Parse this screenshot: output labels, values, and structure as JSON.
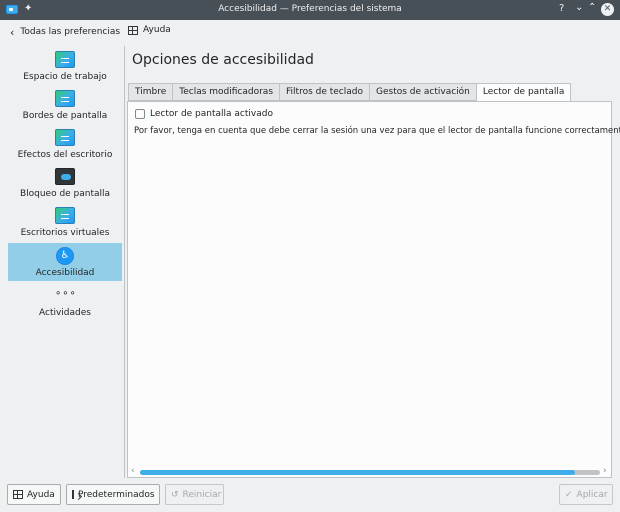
{
  "window": {
    "title": "Accesibilidad  — Preferencias del sistema",
    "help_glyph": "?",
    "minimize_glyph": "⌄",
    "maximize_glyph": "⌃",
    "close_glyph": "✕"
  },
  "toolbar": {
    "back_glyph": "‹",
    "back_label": "Todas las preferencias",
    "help_label": "Ayuda"
  },
  "sidebar": {
    "items": [
      {
        "label": "Espacio de trabajo",
        "icon": "workspace-icon"
      },
      {
        "label": "Bordes de pantalla",
        "icon": "screen-edges-icon"
      },
      {
        "label": "Efectos del escritorio",
        "icon": "desktop-effects-icon"
      },
      {
        "label": "Bloqueo de pantalla",
        "icon": "screen-lock-icon"
      },
      {
        "label": "Escritorios virtuales",
        "icon": "virtual-desktops-icon"
      },
      {
        "label": "Accesibilidad",
        "icon": "accessibility-icon",
        "glyph": "♿",
        "active": true
      },
      {
        "label": "Actividades",
        "icon": "activities-icon",
        "glyph": "∘∘∘"
      }
    ],
    "active_color": "#93cee9"
  },
  "main": {
    "heading": "Opciones de accesibilidad",
    "tabs": [
      {
        "label": "Timbre"
      },
      {
        "label": "Teclas modificadoras"
      },
      {
        "label": "Filtros de teclado"
      },
      {
        "label": "Gestos de activación"
      },
      {
        "label": "Lector de pantalla",
        "active": true
      }
    ],
    "panel": {
      "checkbox_label": "Lector de pantalla activado",
      "checkbox_checked": false,
      "notice": "Por favor, tenga en cuenta que debe cerrar la sesión una vez para que el lector de pantalla funcione correctamente."
    }
  },
  "scrollbar": {
    "left_arrow": "‹",
    "right_arrow": "›"
  },
  "footer": {
    "help_label": "Ayuda",
    "defaults_label": "Predeterminados",
    "reset_glyph": "↺",
    "reset_label": "Reiniciar",
    "apply_glyph": "✓",
    "apply_label": "Aplicar"
  },
  "colors": {
    "titlebar": "#475057",
    "accent": "#3daee9",
    "window_bg": "#eff0f1",
    "panel_bg": "#fcfcfc"
  }
}
